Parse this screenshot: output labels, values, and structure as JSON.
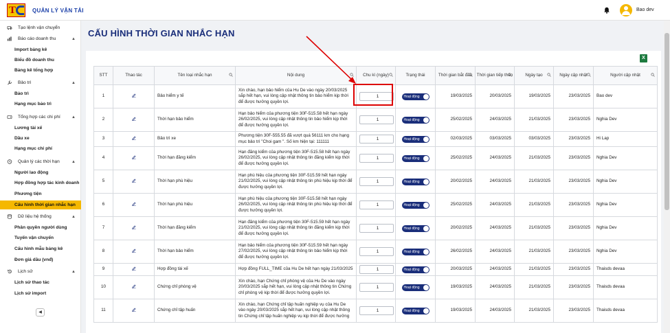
{
  "header": {
    "app_title": "QUẢN LÝ VẬN TẢI",
    "username": "Bao dev",
    "icons": {
      "bell": "bell-icon",
      "avatar": "user-avatar-icon"
    }
  },
  "sidebar": {
    "groups": [
      {
        "label": "Tạo lệnh vận chuyển",
        "icon": "truck-icon",
        "items": []
      },
      {
        "label": "Báo cáo doanh thu",
        "icon": "bar-chart-icon",
        "items": [
          "Import bảng kê",
          "Biểu đồ doanh thu",
          "Bảng kê tổng hợp"
        ]
      },
      {
        "label": "Bảo trì",
        "icon": "wrench-icon",
        "items": [
          "Bảo trì",
          "Hạng mục bảo trì"
        ]
      },
      {
        "label": "Tổng hợp các chi phí",
        "icon": "wallet-icon",
        "items": [
          "Lương tài xế",
          "Dầu xe",
          "Hạng mục chi phí"
        ]
      },
      {
        "label": "Quản lý các thời hạn",
        "icon": "clock-icon",
        "items": [
          "Người lao động",
          "Hợp đồng hợp tác kinh doanh",
          "Phương tiện",
          "Cấu hình thời gian nhắc hạn"
        ]
      },
      {
        "label": "Dữ liệu hệ thống",
        "icon": "database-icon",
        "items": [
          "Phân quyền người dùng",
          "Tuyến vận chuyển",
          "Cấu hình mẫu bảng kê",
          "Đơn giá dầu (vnđ)"
        ]
      },
      {
        "label": "Lịch sử",
        "icon": "history-icon",
        "items": [
          "Lịch sử thao tác",
          "Lịch sử import"
        ]
      }
    ],
    "active_item": "Cấu hình thời gian nhắc hạn",
    "collapse_icon": "chevron-left-icon"
  },
  "page": {
    "title": "CẤU HÌNH THỜI GIAN NHẮC HẠN",
    "export_icon": "excel-export-icon"
  },
  "table": {
    "columns": [
      "STT",
      "Thao tác",
      "Tên loại nhắc hạn",
      "Nội dung",
      "Chu kì (ngày)",
      "Trạng thái",
      "Thời gian bắt đầu",
      "Thời gian tiếp theo",
      "Ngày tạo",
      "Ngày cập nhật",
      "Người cập nhật"
    ],
    "rows": [
      {
        "stt": "1",
        "name": "Bảo hiểm y tế",
        "content": "Xin chào, hạn bảo hiểm của Hu De vào ngày 20/03/2025 sắp hết hạn, vui lòng cập nhật thông tin bảo hiểm kịp thời để được hưởng quyền lợi.",
        "cycle": "1",
        "status": "Hoạt động",
        "start": "19/03/2025",
        "next": "20/03/2025",
        "created": "19/03/2025",
        "updated": "23/03/2025",
        "updated_by": "Bao dev"
      },
      {
        "stt": "2",
        "name": "Thời hạn bảo hiểm",
        "content": "Hạn bảo hiểm của phương tiện 30F-515.58 hết hạn ngày 26/02/2025, vui lòng cập nhật thông tin bảo hiểm kịp thời để được hưởng quyền lợi.",
        "cycle": "1",
        "status": "Hoạt động",
        "start": "25/02/2025",
        "next": "24/03/2025",
        "created": "21/03/2025",
        "updated": "23/03/2025",
        "updated_by": "Nghia Dev"
      },
      {
        "stt": "3",
        "name": "Bảo trì xe",
        "content": "Phương tiện 30F-555.55 đã vượt quá 56111 km cho hạng mục bảo trì \"Choi gam \". Số km hiện tại: 111111",
        "cycle": "1",
        "status": "Hoạt động",
        "start": "02/03/2025",
        "next": "03/03/2025",
        "created": "03/03/2025",
        "updated": "23/03/2025",
        "updated_by": "Hi Lap"
      },
      {
        "stt": "4",
        "name": "Thời hạn đăng kiểm",
        "content": "Hạn đăng kiểm của phương tiện 30F-515.58 hết hạn ngày 26/02/2025, vui lòng cập nhật thông tin đăng kiểm kịp thời để được hưởng quyền lợi.",
        "cycle": "1",
        "status": "Hoạt động",
        "start": "25/02/2025",
        "next": "24/03/2025",
        "created": "21/03/2025",
        "updated": "23/03/2025",
        "updated_by": "Nghia Dev"
      },
      {
        "stt": "5",
        "name": "Thời hạn phù hiệu",
        "content": "Hạn phù hiệu của phương tiện 30F-515.59 hết hạn ngày 21/02/2025, vui lòng cập nhật thông tin phù hiệu kịp thời để được hưởng quyền lợi.",
        "cycle": "1",
        "status": "Hoạt động",
        "start": "20/02/2025",
        "next": "24/03/2025",
        "created": "21/03/2025",
        "updated": "23/03/2025",
        "updated_by": "Nghia Dev"
      },
      {
        "stt": "6",
        "name": "Thời hạn phù hiệu",
        "content": "Hạn phù hiệu của phương tiện 30F-515.58 hết hạn ngày 26/02/2025, vui lòng cập nhật thông tin phù hiệu kịp thời để được hưởng quyền lợi.",
        "cycle": "1",
        "status": "Hoạt động",
        "start": "25/02/2025",
        "next": "24/03/2025",
        "created": "21/03/2025",
        "updated": "23/03/2025",
        "updated_by": "Nghia Dev"
      },
      {
        "stt": "7",
        "name": "Thời hạn đăng kiểm",
        "content": "Hạn đăng kiểm của phương tiện 30F-515.59 hết hạn ngày 21/02/2025, vui lòng cập nhật thông tin đăng kiểm kịp thời để được hưởng quyền lợi.",
        "cycle": "1",
        "status": "Hoạt động",
        "start": "20/02/2025",
        "next": "24/03/2025",
        "created": "21/03/2025",
        "updated": "23/03/2025",
        "updated_by": "Nghia Dev"
      },
      {
        "stt": "8",
        "name": "Thời hạn bảo hiểm",
        "content": "Hạn bảo hiểm của phương tiện 30F-515.59 hết hạn ngày 27/02/2025, vui lòng cập nhật thông tin bảo hiểm kịp thời để được hưởng quyền lợi.",
        "cycle": "1",
        "status": "Hoạt động",
        "start": "26/02/2025",
        "next": "24/03/2025",
        "created": "21/03/2025",
        "updated": "23/03/2025",
        "updated_by": "Nghia Dev"
      },
      {
        "stt": "9",
        "name": "Hợp đồng tài xế",
        "content": "Hợp đồng FULL_TIME của Hu De hết hạn ngày 21/03/2025",
        "cycle": "1",
        "status": "Hoạt động",
        "start": "20/03/2025",
        "next": "24/03/2025",
        "created": "21/03/2025",
        "updated": "23/03/2025",
        "updated_by": "Thaisds devaa"
      },
      {
        "stt": "10",
        "name": "Chứng chỉ phòng vệ",
        "content": "Xin chào, hạn Chứng chỉ phòng vệ của Hu De vào ngày 20/03/2025 sắp hết hạn, vui lòng cập nhật thông tin Chứng chỉ phòng vệ kịp thời để được hưởng quyền lợi.",
        "cycle": "1",
        "status": "Hoạt động",
        "start": "19/03/2025",
        "next": "24/03/2025",
        "created": "21/03/2025",
        "updated": "23/03/2025",
        "updated_by": "Thaisds devaa"
      },
      {
        "stt": "11",
        "name": "Chứng chỉ tập huấn",
        "content": "Xin chào, hạn Chứng chỉ tập huấn nghiệp vụ của Hu De vào ngày 20/03/2025 sắp hết hạn, vui lòng cập nhật thông tin Chứng chỉ tập huấn nghiệp vụ kịp thời để được hưởng",
        "cycle": "1",
        "status": "Hoạt động",
        "start": "19/03/2025",
        "next": "24/03/2025",
        "created": "21/03/2025",
        "updated": "23/03/2025",
        "updated_by": "Thaisds devaa"
      }
    ],
    "icons": {
      "edit": "edit-pencil-icon",
      "search": "search-icon",
      "toggle": "toggle-switch-icon"
    }
  },
  "annotation": {
    "arrow_color": "#d00000",
    "highlight_color": "#d00000"
  },
  "colors": {
    "accent": "#f5b800",
    "brand_blue": "#1a2e7a",
    "toggle_on": "#1a2e7a"
  }
}
